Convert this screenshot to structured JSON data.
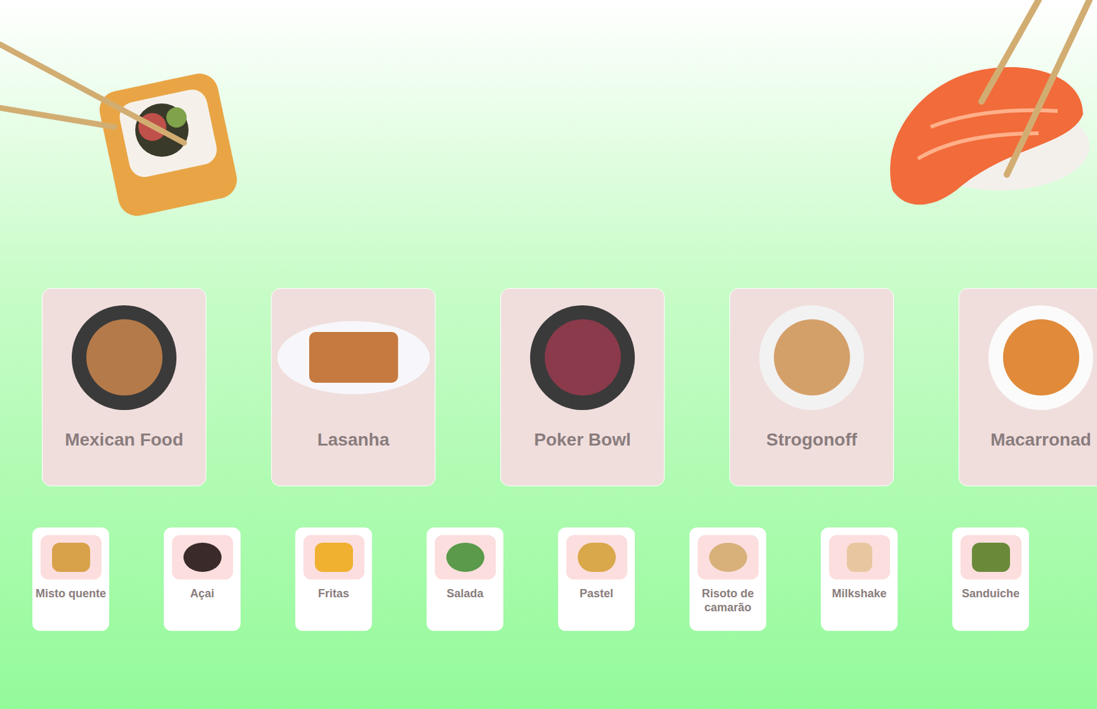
{
  "hero": {
    "left_photo": "sushi-roll",
    "right_photo": "salmon-nigiri"
  },
  "featured": [
    {
      "label": "Mexican Food"
    },
    {
      "label": "Lasanha"
    },
    {
      "label": "Poker Bowl"
    },
    {
      "label": "Strogonoff"
    },
    {
      "label": "Macarronad"
    }
  ],
  "categories": [
    {
      "label": "Misto quente"
    },
    {
      "label": "Açai"
    },
    {
      "label": "Fritas"
    },
    {
      "label": "Salada"
    },
    {
      "label": "Pastel"
    },
    {
      "label": "Risoto de camarão"
    },
    {
      "label": "Milkshake"
    },
    {
      "label": "Sanduiche"
    }
  ]
}
